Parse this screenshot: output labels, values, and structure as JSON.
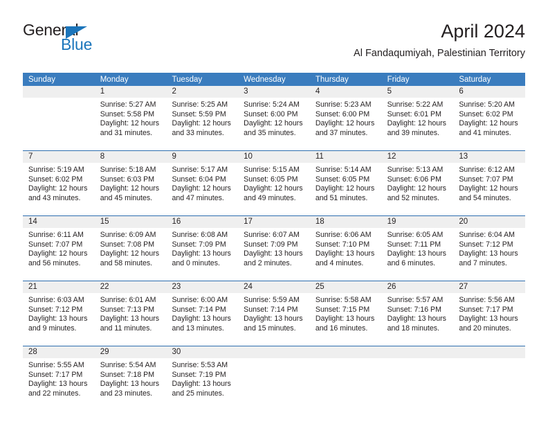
{
  "brand": {
    "name_top": "General",
    "name_bottom": "Blue",
    "accent_color": "#1b75bb",
    "triangle_icon": "brand-triangle-icon"
  },
  "header": {
    "title": "April 2024",
    "subtitle": "Al Fandaqumiyah, Palestinian Territory"
  },
  "theme": {
    "header_blue": "#3a7cbe",
    "row_divider_blue": "#2f6fb0",
    "date_band_gray": "#efefef",
    "text_color": "#231f20"
  },
  "weekdays": [
    "Sunday",
    "Monday",
    "Tuesday",
    "Wednesday",
    "Thursday",
    "Friday",
    "Saturday"
  ],
  "weeks": [
    {
      "days": [
        {
          "num": "",
          "sunrise": "",
          "sunset": "",
          "daylight_1": "",
          "daylight_2": "",
          "empty": true
        },
        {
          "num": "1",
          "sunrise": "Sunrise: 5:27 AM",
          "sunset": "Sunset: 5:58 PM",
          "daylight_1": "Daylight: 12 hours",
          "daylight_2": "and 31 minutes."
        },
        {
          "num": "2",
          "sunrise": "Sunrise: 5:25 AM",
          "sunset": "Sunset: 5:59 PM",
          "daylight_1": "Daylight: 12 hours",
          "daylight_2": "and 33 minutes."
        },
        {
          "num": "3",
          "sunrise": "Sunrise: 5:24 AM",
          "sunset": "Sunset: 6:00 PM",
          "daylight_1": "Daylight: 12 hours",
          "daylight_2": "and 35 minutes."
        },
        {
          "num": "4",
          "sunrise": "Sunrise: 5:23 AM",
          "sunset": "Sunset: 6:00 PM",
          "daylight_1": "Daylight: 12 hours",
          "daylight_2": "and 37 minutes."
        },
        {
          "num": "5",
          "sunrise": "Sunrise: 5:22 AM",
          "sunset": "Sunset: 6:01 PM",
          "daylight_1": "Daylight: 12 hours",
          "daylight_2": "and 39 minutes."
        },
        {
          "num": "6",
          "sunrise": "Sunrise: 5:20 AM",
          "sunset": "Sunset: 6:02 PM",
          "daylight_1": "Daylight: 12 hours",
          "daylight_2": "and 41 minutes."
        }
      ]
    },
    {
      "days": [
        {
          "num": "7",
          "sunrise": "Sunrise: 5:19 AM",
          "sunset": "Sunset: 6:02 PM",
          "daylight_1": "Daylight: 12 hours",
          "daylight_2": "and 43 minutes."
        },
        {
          "num": "8",
          "sunrise": "Sunrise: 5:18 AM",
          "sunset": "Sunset: 6:03 PM",
          "daylight_1": "Daylight: 12 hours",
          "daylight_2": "and 45 minutes."
        },
        {
          "num": "9",
          "sunrise": "Sunrise: 5:17 AM",
          "sunset": "Sunset: 6:04 PM",
          "daylight_1": "Daylight: 12 hours",
          "daylight_2": "and 47 minutes."
        },
        {
          "num": "10",
          "sunrise": "Sunrise: 5:15 AM",
          "sunset": "Sunset: 6:05 PM",
          "daylight_1": "Daylight: 12 hours",
          "daylight_2": "and 49 minutes."
        },
        {
          "num": "11",
          "sunrise": "Sunrise: 5:14 AM",
          "sunset": "Sunset: 6:05 PM",
          "daylight_1": "Daylight: 12 hours",
          "daylight_2": "and 51 minutes."
        },
        {
          "num": "12",
          "sunrise": "Sunrise: 5:13 AM",
          "sunset": "Sunset: 6:06 PM",
          "daylight_1": "Daylight: 12 hours",
          "daylight_2": "and 52 minutes."
        },
        {
          "num": "13",
          "sunrise": "Sunrise: 6:12 AM",
          "sunset": "Sunset: 7:07 PM",
          "daylight_1": "Daylight: 12 hours",
          "daylight_2": "and 54 minutes."
        }
      ]
    },
    {
      "days": [
        {
          "num": "14",
          "sunrise": "Sunrise: 6:11 AM",
          "sunset": "Sunset: 7:07 PM",
          "daylight_1": "Daylight: 12 hours",
          "daylight_2": "and 56 minutes."
        },
        {
          "num": "15",
          "sunrise": "Sunrise: 6:09 AM",
          "sunset": "Sunset: 7:08 PM",
          "daylight_1": "Daylight: 12 hours",
          "daylight_2": "and 58 minutes."
        },
        {
          "num": "16",
          "sunrise": "Sunrise: 6:08 AM",
          "sunset": "Sunset: 7:09 PM",
          "daylight_1": "Daylight: 13 hours",
          "daylight_2": "and 0 minutes."
        },
        {
          "num": "17",
          "sunrise": "Sunrise: 6:07 AM",
          "sunset": "Sunset: 7:09 PM",
          "daylight_1": "Daylight: 13 hours",
          "daylight_2": "and 2 minutes."
        },
        {
          "num": "18",
          "sunrise": "Sunrise: 6:06 AM",
          "sunset": "Sunset: 7:10 PM",
          "daylight_1": "Daylight: 13 hours",
          "daylight_2": "and 4 minutes."
        },
        {
          "num": "19",
          "sunrise": "Sunrise: 6:05 AM",
          "sunset": "Sunset: 7:11 PM",
          "daylight_1": "Daylight: 13 hours",
          "daylight_2": "and 6 minutes."
        },
        {
          "num": "20",
          "sunrise": "Sunrise: 6:04 AM",
          "sunset": "Sunset: 7:12 PM",
          "daylight_1": "Daylight: 13 hours",
          "daylight_2": "and 7 minutes."
        }
      ]
    },
    {
      "days": [
        {
          "num": "21",
          "sunrise": "Sunrise: 6:03 AM",
          "sunset": "Sunset: 7:12 PM",
          "daylight_1": "Daylight: 13 hours",
          "daylight_2": "and 9 minutes."
        },
        {
          "num": "22",
          "sunrise": "Sunrise: 6:01 AM",
          "sunset": "Sunset: 7:13 PM",
          "daylight_1": "Daylight: 13 hours",
          "daylight_2": "and 11 minutes."
        },
        {
          "num": "23",
          "sunrise": "Sunrise: 6:00 AM",
          "sunset": "Sunset: 7:14 PM",
          "daylight_1": "Daylight: 13 hours",
          "daylight_2": "and 13 minutes."
        },
        {
          "num": "24",
          "sunrise": "Sunrise: 5:59 AM",
          "sunset": "Sunset: 7:14 PM",
          "daylight_1": "Daylight: 13 hours",
          "daylight_2": "and 15 minutes."
        },
        {
          "num": "25",
          "sunrise": "Sunrise: 5:58 AM",
          "sunset": "Sunset: 7:15 PM",
          "daylight_1": "Daylight: 13 hours",
          "daylight_2": "and 16 minutes."
        },
        {
          "num": "26",
          "sunrise": "Sunrise: 5:57 AM",
          "sunset": "Sunset: 7:16 PM",
          "daylight_1": "Daylight: 13 hours",
          "daylight_2": "and 18 minutes."
        },
        {
          "num": "27",
          "sunrise": "Sunrise: 5:56 AM",
          "sunset": "Sunset: 7:17 PM",
          "daylight_1": "Daylight: 13 hours",
          "daylight_2": "and 20 minutes."
        }
      ]
    },
    {
      "days": [
        {
          "num": "28",
          "sunrise": "Sunrise: 5:55 AM",
          "sunset": "Sunset: 7:17 PM",
          "daylight_1": "Daylight: 13 hours",
          "daylight_2": "and 22 minutes."
        },
        {
          "num": "29",
          "sunrise": "Sunrise: 5:54 AM",
          "sunset": "Sunset: 7:18 PM",
          "daylight_1": "Daylight: 13 hours",
          "daylight_2": "and 23 minutes."
        },
        {
          "num": "30",
          "sunrise": "Sunrise: 5:53 AM",
          "sunset": "Sunset: 7:19 PM",
          "daylight_1": "Daylight: 13 hours",
          "daylight_2": "and 25 minutes."
        },
        {
          "num": "",
          "sunrise": "",
          "sunset": "",
          "daylight_1": "",
          "daylight_2": "",
          "empty": true
        },
        {
          "num": "",
          "sunrise": "",
          "sunset": "",
          "daylight_1": "",
          "daylight_2": "",
          "empty": true
        },
        {
          "num": "",
          "sunrise": "",
          "sunset": "",
          "daylight_1": "",
          "daylight_2": "",
          "empty": true
        },
        {
          "num": "",
          "sunrise": "",
          "sunset": "",
          "daylight_1": "",
          "daylight_2": "",
          "empty": true
        }
      ]
    }
  ]
}
